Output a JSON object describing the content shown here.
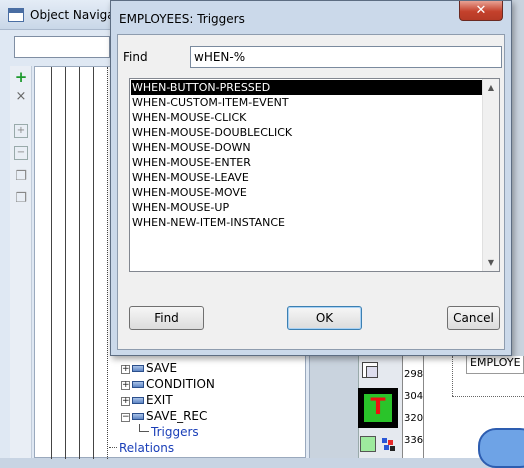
{
  "navigator": {
    "title": "Object Navigator",
    "tree_items": [
      {
        "label": "SAVE",
        "toggle": "+"
      },
      {
        "label": "CONDITION",
        "toggle": "+"
      },
      {
        "label": "EXIT",
        "toggle": "+"
      },
      {
        "label": "SAVE_REC",
        "toggle": "−"
      },
      {
        "label": "Triggers"
      },
      {
        "label": "Relations"
      }
    ]
  },
  "dialog": {
    "title": "EMPLOYEES: Triggers",
    "close_symbol": "✕",
    "find_label": "Find",
    "find_value": "wHEN-%",
    "triggers": [
      "WHEN-BUTTON-PRESSED",
      "WHEN-CUSTOM-ITEM-EVENT",
      "WHEN-MOUSE-CLICK",
      "WHEN-MOUSE-DOUBLECLICK",
      "WHEN-MOUSE-DOWN",
      "WHEN-MOUSE-ENTER",
      "WHEN-MOUSE-LEAVE",
      "WHEN-MOUSE-MOVE",
      "WHEN-MOUSE-UP",
      "WHEN-NEW-ITEM-INSTANCE"
    ],
    "selected_index": 0,
    "buttons": {
      "find": "Find",
      "ok": "OK",
      "cancel": "Cancel"
    }
  },
  "layout_editor": {
    "ruler_numbers": [
      "298",
      "304",
      "320",
      "336"
    ],
    "canvas_label": "EMPLOYE",
    "text_tool_letter": "T"
  },
  "colors": {
    "selection_bg": "#000000",
    "close_button": "#c4412c",
    "link": "#1a3fb8"
  }
}
